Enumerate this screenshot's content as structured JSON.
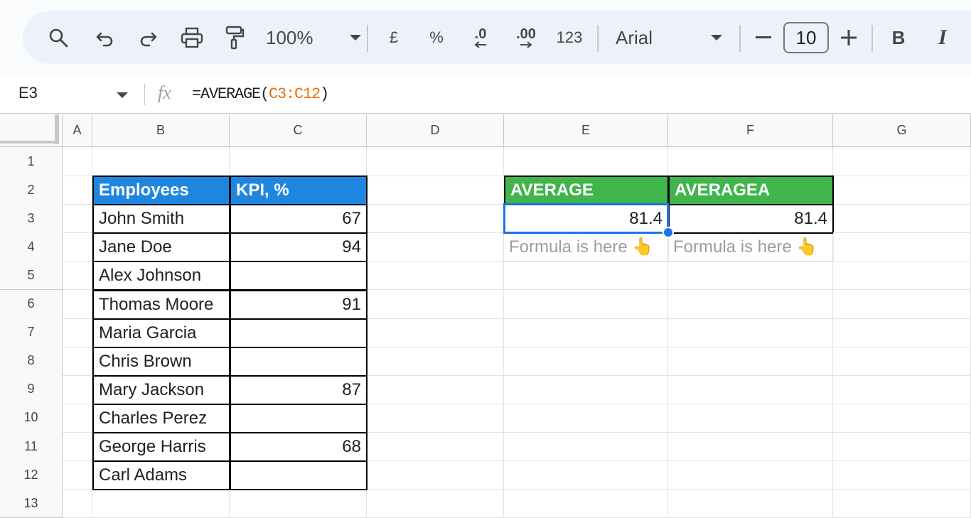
{
  "toolbar": {
    "zoom": "100%",
    "currency": "£",
    "percent": "%",
    "decrease_decimal": ".0",
    "increase_decimal": ".00",
    "number_format": "123",
    "font": "Arial",
    "font_size": "10",
    "bold": "B",
    "italic": "I"
  },
  "formula_bar": {
    "cell_ref": "E3",
    "fx": "fx",
    "formula_prefix": "=AVERAGE(",
    "formula_range": "C3:C12",
    "formula_suffix": ")"
  },
  "grid": {
    "columns": [
      "A",
      "B",
      "C",
      "D",
      "E",
      "F",
      "G"
    ],
    "rows": [
      "1",
      "2",
      "3",
      "4",
      "5",
      "6",
      "7",
      "8",
      "9",
      "10",
      "11",
      "12",
      "13"
    ],
    "table": {
      "headers": [
        "Employees",
        "KPI, %"
      ],
      "employees": [
        "John Smith",
        "Jane Doe",
        "Alex Johnson",
        "Thomas Moore",
        "Maria Garcia",
        "Chris Brown",
        "Mary Jackson",
        "Charles Perez",
        "George Harris",
        "Carl Adams"
      ],
      "kpi": [
        "67",
        "94",
        "",
        "91",
        "",
        "",
        "87",
        "",
        "68",
        ""
      ]
    },
    "results": {
      "average_label": "AVERAGE",
      "averagea_label": "AVERAGEA",
      "average_value": "81.4",
      "averagea_value": "81.4",
      "note_e": "Formula is here 👆",
      "note_f": "Formula is here 👆"
    },
    "colors": {
      "header_blue": "#1f86e0",
      "header_green": "#3fb54b",
      "selection": "#1a73e8",
      "formula_range": "#e8710a"
    }
  }
}
